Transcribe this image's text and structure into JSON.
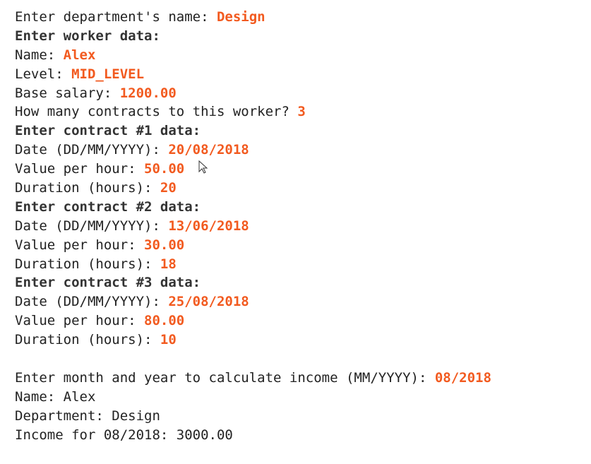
{
  "console": {
    "lines": [
      {
        "prompt": "Enter department's name: ",
        "input": "Design",
        "bold": false
      },
      {
        "prompt": "Enter worker data:",
        "input": "",
        "bold": true
      },
      {
        "prompt": "Name: ",
        "input": "Alex",
        "bold": false
      },
      {
        "prompt": "Level: ",
        "input": "MID_LEVEL",
        "bold": false
      },
      {
        "prompt": "Base salary: ",
        "input": "1200.00",
        "bold": false
      },
      {
        "prompt": "How many contracts to this worker? ",
        "input": "3",
        "bold": false
      },
      {
        "prompt": "Enter contract #1 data:",
        "input": "",
        "bold": true
      },
      {
        "prompt": "Date (DD/MM/YYYY): ",
        "input": "20/08/2018",
        "bold": false
      },
      {
        "prompt": "Value per hour: ",
        "input": "50.00",
        "bold": false
      },
      {
        "prompt": "Duration (hours): ",
        "input": "20",
        "bold": false
      },
      {
        "prompt": "Enter contract #2 data:",
        "input": "",
        "bold": true
      },
      {
        "prompt": "Date (DD/MM/YYYY): ",
        "input": "13/06/2018",
        "bold": false
      },
      {
        "prompt": "Value per hour: ",
        "input": "30.00",
        "bold": false
      },
      {
        "prompt": "Duration (hours): ",
        "input": "18",
        "bold": false
      },
      {
        "prompt": "Enter contract #3 data:",
        "input": "",
        "bold": true
      },
      {
        "prompt": "Date (DD/MM/YYYY): ",
        "input": "25/08/2018",
        "bold": false
      },
      {
        "prompt": "Value per hour: ",
        "input": "80.00",
        "bold": false
      },
      {
        "prompt": "Duration (hours): ",
        "input": "10",
        "bold": false
      },
      {
        "prompt": "",
        "input": "",
        "bold": false,
        "blank": true
      },
      {
        "prompt": "Enter month and year to calculate income (MM/YYYY): ",
        "input": "08/2018",
        "bold": false
      },
      {
        "prompt": "Name: Alex",
        "input": "",
        "bold": false
      },
      {
        "prompt": "Department: Design",
        "input": "",
        "bold": false
      },
      {
        "prompt": "Income for 08/2018: 3000.00",
        "input": "",
        "bold": false
      }
    ]
  },
  "colors": {
    "input_text": "#f25a1f",
    "output_text": "#222222",
    "background": "#ffffff"
  },
  "icons": {
    "cursor": "mouse-pointer-icon"
  }
}
